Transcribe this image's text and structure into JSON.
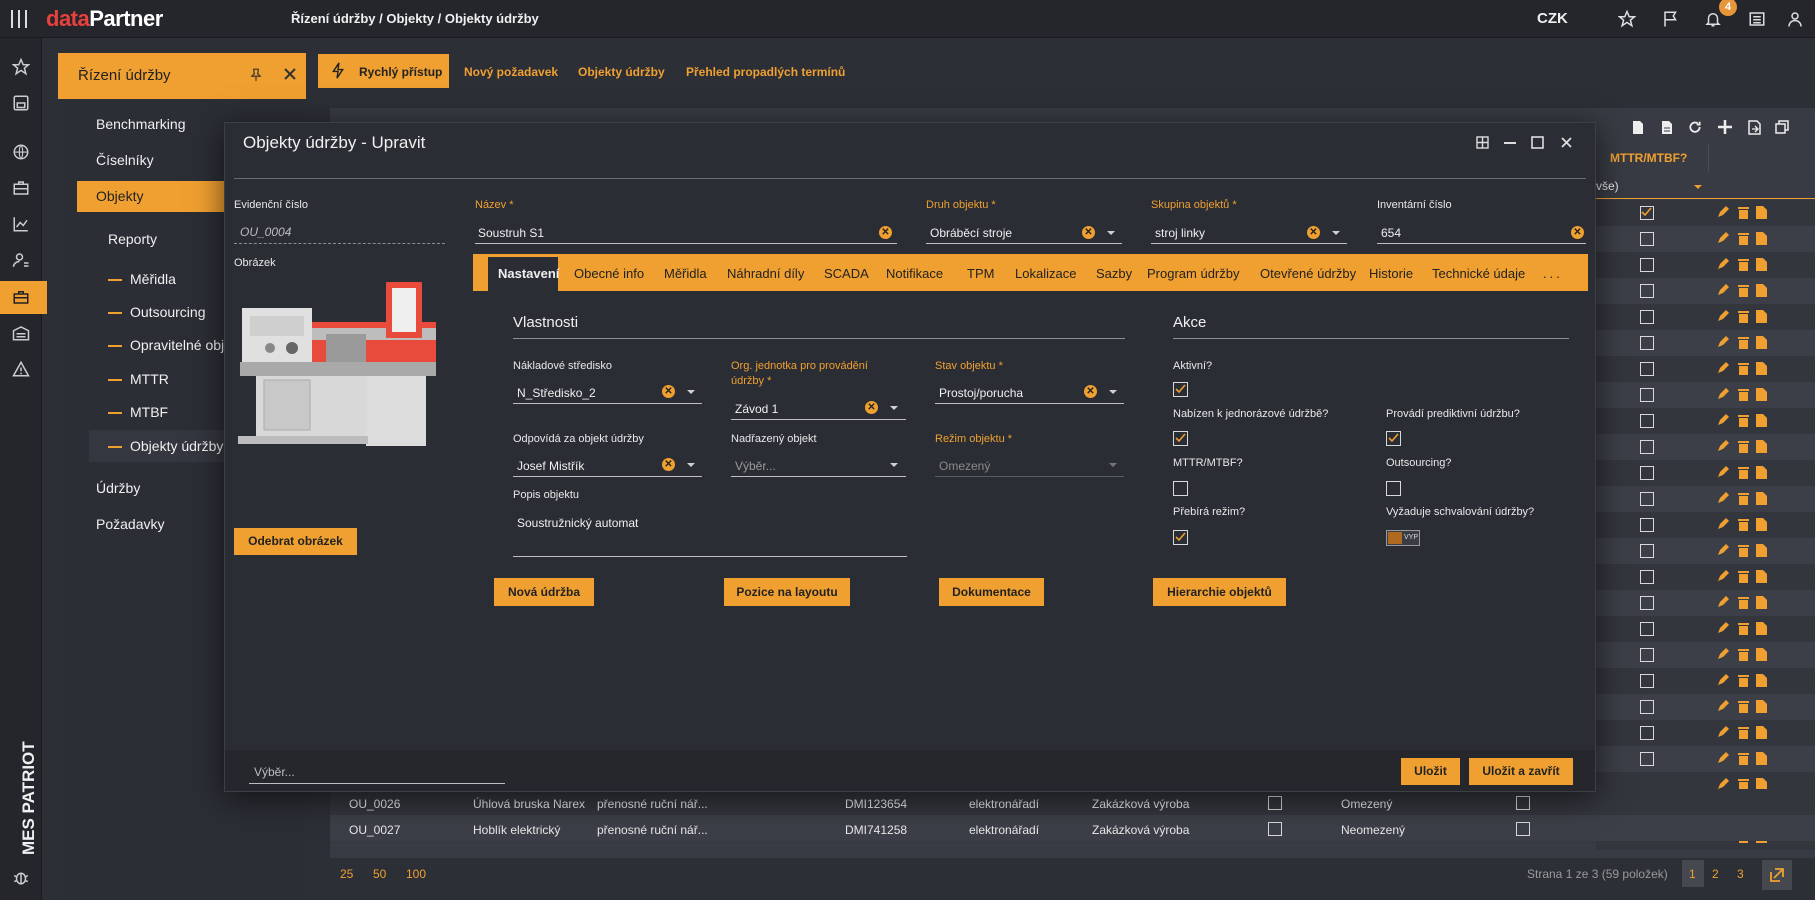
{
  "topbar": {
    "brand_part1": "data",
    "brand_part2": "Partner",
    "breadcrumb": "Řízení údržby / Objekty / Objekty údržby",
    "currency": "CZK",
    "notification_count": "4"
  },
  "rail": {
    "product_name": "MES PATRIOT",
    "icons": [
      "star-icon",
      "save-icon",
      "globe-icon",
      "briefcase-icon",
      "chart-icon",
      "user-settings-icon",
      "toolbox-icon",
      "warehouse-icon",
      "warning-icon",
      "bug-icon"
    ]
  },
  "nav": {
    "title": "Řízení údržby",
    "items": [
      "Benchmarking",
      "Číselníky",
      "Objekty",
      "Reporty"
    ],
    "sub_items": [
      "Měřidla",
      "Outsourcing",
      "Opravitelné obj",
      "MTTR",
      "MTBF",
      "Objekty údržby"
    ],
    "bottom_items": [
      "Údržby",
      "Požadavky"
    ]
  },
  "tabs": [
    "Rychlý přístup",
    "Nový požadavek",
    "Objekty údržby",
    "Přehled propadlých termínů"
  ],
  "grid": {
    "header_col": "MTTR/MTBF?",
    "filter_value": "vše)",
    "rows": [
      {
        "id": "OU_0026",
        "name": "Úhlová bruska Narex",
        "type": "přenosné ruční nář...",
        "inv": "DMI123654",
        "kind": "elektronářadí",
        "group": "Zakázková výroba",
        "regime": "Omezený"
      },
      {
        "id": "OU_0027",
        "name": "Hoblík elektrický",
        "type": "přenosné ruční nář...",
        "inv": "DMI741258",
        "kind": "elektronářadí",
        "group": "Zakázková výroba",
        "regime": "Neomezený"
      }
    ],
    "page_sizes": [
      "25",
      "50",
      "100"
    ],
    "page_info": "Strana 1 ze 3 (59 položek)",
    "pages": [
      "1",
      "2",
      "3"
    ]
  },
  "modal": {
    "title": "Objekty údržby - Upravit",
    "evid_label": "Evidenční číslo",
    "evid_value": "OU_0004",
    "image_label": "Obrázek",
    "remove_image": "Odebrat obrázek",
    "name_label": "Název *",
    "name_value": "Soustruh S1",
    "kind_label": "Druh objektu *",
    "kind_value": "Obráběcí stroje",
    "group_label": "Skupina objektů *",
    "group_value": "stroj linky",
    "inv_label": "Inventární číslo",
    "inv_value": "654",
    "tabs": [
      "Nastavení",
      "Obecné info",
      "Měřidla",
      "Náhradní díly",
      "SCADA",
      "Notifikace",
      "TPM",
      "Lokalizace",
      "Sazby",
      "Program údržby",
      "Otevřené údržby",
      "Historie",
      "Technické údaje",
      "..."
    ],
    "props_title": "Vlastnosti",
    "actions_title": "Akce",
    "cost_center_label": "Nákladové středisko",
    "cost_center_value": "N_Středisko_2",
    "org_unit_label_1": "Org. jednotka pro provádění",
    "org_unit_label_2": "údržby *",
    "org_unit_value": "Závod 1",
    "state_label": "Stav objektu *",
    "state_value": "Prostoj/porucha",
    "responsible_label": "Odpovídá za objekt údržby",
    "responsible_value": "Josef Mistřík",
    "parent_label": "Nadřazený objekt",
    "parent_placeholder": "Výběr...",
    "regime_label": "Režim objektu *",
    "regime_value": "Omezený",
    "desc_label": "Popis objektu",
    "desc_value": "Soustružnický automat",
    "chk_active": "Aktivní?",
    "chk_offered": "Nabízen k jednorázové údržbě?",
    "chk_predictive": "Provádí prediktivní údržbu?",
    "chk_mttr": "MTTR/MTBF?",
    "chk_outsourcing": "Outsourcing?",
    "chk_takes_regime": "Přebírá režim?",
    "chk_approval": "Vyžaduje schvalování údržby?",
    "toggle_text": "VYP",
    "btn_new": "Nová údržba",
    "btn_layout": "Pozice na layoutu",
    "btn_docs": "Dokumentace",
    "btn_hierarchy": "Hierarchie objektů",
    "footer_placeholder": "Výběr...",
    "btn_save": "Uložit",
    "btn_save_close": "Uložit a zavřít"
  },
  "colors": {
    "accent": "#f0a030",
    "background": "#2c2f36",
    "panel": "#2a2d34",
    "brand_red": "#e8413c"
  }
}
